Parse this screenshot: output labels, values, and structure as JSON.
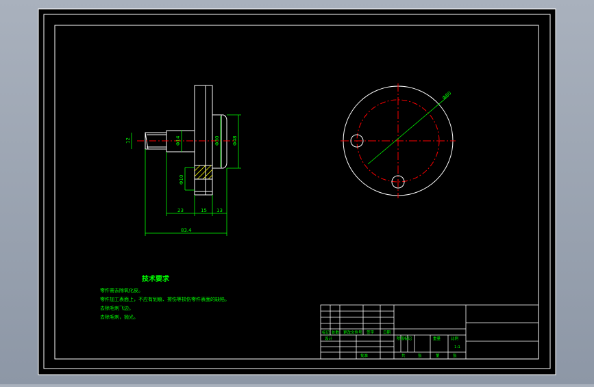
{
  "colors": {
    "background_outer": "#9aa3b0",
    "canvas": "#000000",
    "frame": "#ffffff",
    "part_outline": "#ffffff",
    "dimension": "#00ff00",
    "centerline": "#ff0000",
    "hatch": "#ffff00",
    "text_green": "#00ff00"
  },
  "drawing": {
    "side_view": {
      "dim_left_shaft": "12",
      "dim_shaft_dia": "Φ14",
      "dim_bore_dia": "Φ30",
      "dim_flange_dia": "Φ48",
      "dim_hole_dia": "Φ10",
      "dim_len_a": "23",
      "dim_len_b": "15",
      "dim_len_c": "13",
      "dim_total_len": "83.4"
    },
    "front_view": {
      "dim_pcd": "Φ80"
    }
  },
  "notes": {
    "title": "技术要求",
    "lines": [
      "零件需去除氧化皮。",
      "零件加工表面上，不应有划痕、擦伤等损伤零件表面的缺陷。",
      "去除毛刺飞边。",
      "去除毛刺，抛光。"
    ]
  },
  "title_block": {
    "labels": {
      "mark": "标记",
      "count": "处数",
      "change_doc": "更改文件号",
      "sign": "签字",
      "date": "日期",
      "design": "设计",
      "stage_mark": "阶段标记",
      "weight": "重量",
      "scale": "比例",
      "scale_value": "1:1",
      "approve": "批准",
      "total": "共",
      "sheet": "张",
      "no": "第",
      "sheet2": "张"
    }
  }
}
